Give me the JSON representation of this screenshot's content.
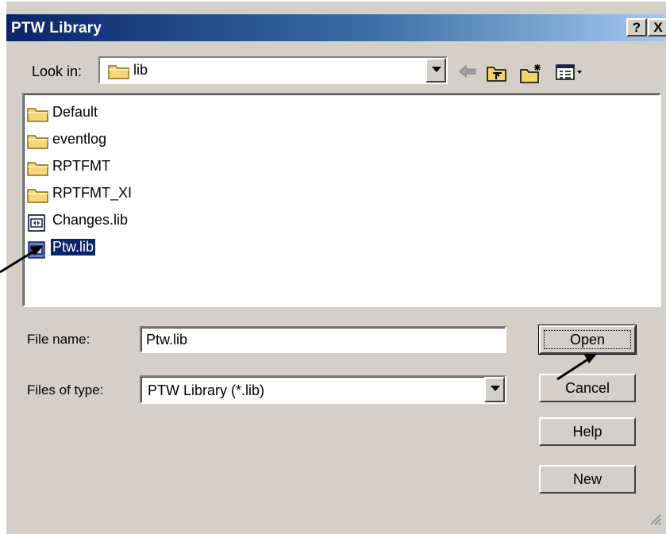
{
  "window": {
    "title": "PTW Library"
  },
  "titlebar_buttons": {
    "help": "?",
    "close": "X"
  },
  "look_in": {
    "label": "Look in:",
    "value": "lib"
  },
  "toolbar": {
    "icons": [
      "back-arrow-icon",
      "up-folder-icon",
      "new-folder-icon",
      "view-menu-icon"
    ]
  },
  "files": [
    {
      "name": "Default",
      "type": "folder"
    },
    {
      "name": "eventlog",
      "type": "folder"
    },
    {
      "name": "RPTFMT",
      "type": "folder"
    },
    {
      "name": "RPTFMT_XI",
      "type": "folder"
    },
    {
      "name": "Changes.lib",
      "type": "file"
    },
    {
      "name": "Ptw.lib",
      "type": "file",
      "selected": true
    }
  ],
  "file_name": {
    "label": "File name:",
    "value": "Ptw.lib"
  },
  "files_of_type": {
    "label": "Files of type:",
    "value": "PTW Library (*.lib)"
  },
  "buttons": {
    "open": "Open",
    "cancel": "Cancel",
    "help": "Help",
    "new": "New"
  },
  "colors": {
    "title_start": "#0a246a",
    "title_end": "#a6caf0",
    "selection": "#0a246a",
    "face": "#d4d0c8"
  }
}
